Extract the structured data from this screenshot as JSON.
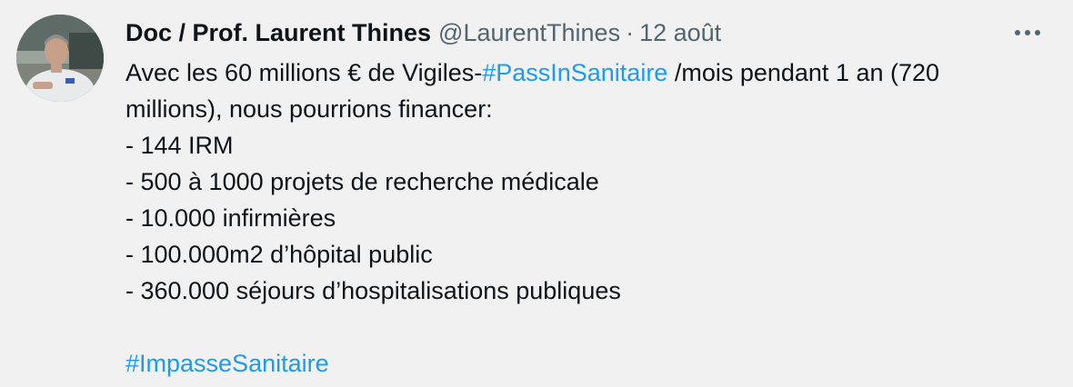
{
  "tweet": {
    "author": {
      "display_name": "Doc / Prof. Laurent Thines",
      "handle": "@LaurentThines",
      "avatar_icon": "profile-photo"
    },
    "separator": "·",
    "date": "12 août",
    "more_icon": "more-horizontal-icon",
    "text": {
      "line1_prefix": "Avec les 60 millions € de Vigiles-",
      "hashtag1": "#PassInSanitaire",
      "line1_suffix": " /mois pendant 1 an (720",
      "line2": "millions), nous pourrions financer:",
      "items": [
        "- 144 IRM",
        "- 500 à 1000 projets de recherche médicale",
        "- 10.000 infirmières",
        "- 100.000m2 d’hôpital public",
        "- 360.000 séjours d’hospitalisations publiques"
      ],
      "hashtag2": "#ImpasseSanitaire"
    },
    "colors": {
      "background": "#f1f1f1",
      "text": "#0f1419",
      "secondary": "#536471",
      "link": "#1d9bf0"
    }
  }
}
